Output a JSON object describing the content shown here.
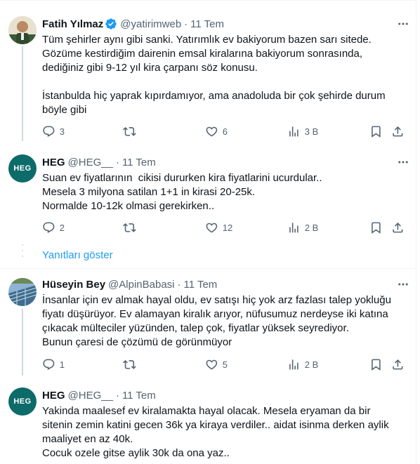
{
  "tweets": [
    {
      "name": "Fatih Yılmaz",
      "handle": "@yatirimweb",
      "date": "11 Tem",
      "text": "Tüm şehirler aynı gibi sanki. Yatırımlık ev bakiyorum bazen sarı sitede.\nGözüme kestirdiğim dairenin emsal kiralarına bakiyorum sonrasında,\ndediğiniz gibi 9-12 yıl kira çarpanı söz konusu.\n\nİstanbulda hiç yaprak kıpırdamıyor, ama anadoluda bir çok şehirde durum\nböyle gibi",
      "replies": "3",
      "retweets": "",
      "likes": "6",
      "views": "3 B"
    },
    {
      "name": "HEG",
      "handle": "@HEG__",
      "date": "11 Tem",
      "avatar_text": "HEG",
      "text": "Suan ev fiyatlarının  cikisi dururken kira fiyatlarini ucurdular..\nMesela 3 milyona satilan 1+1 in kirasi 20-25k.\nNormalde 10-12k olmasi gerekirken..",
      "replies": "2",
      "retweets": "",
      "likes": "12",
      "views": "2 B"
    },
    {
      "name": "Hüseyin Bey",
      "handle": "@AlpinBabasi",
      "date": "11 Tem",
      "text": "İnsanlar için ev almak hayal oldu, ev satışı hiç yok arz fazlası talep yokluğu\nfiyatı düşürüyor. Ev alamayan kiralık arıyor, nüfusumuz nerdeyse iki katına\nçıkacak mülteciler yüzünden, talep çok, fiyatlar yüksek seyrediyor.\nBunun çaresi de çözümü de görünmüyor",
      "replies": "1",
      "retweets": "",
      "likes": "5",
      "views": "2 B"
    },
    {
      "name": "HEG",
      "handle": "@HEG__",
      "date": "11 Tem",
      "avatar_text": "HEG",
      "text": "Yakinda maalesef ev kiralamakta hayal olacak. Mesela eryaman da bir\nsitenin zemin katini gecen 36k ya kiraya verdiler.. aidat isinma derken aylik\nmaaliyet en az 40k.\nCocuk ozele gitse aylik 30k da ona yaz..",
      "replies": "",
      "retweets": "",
      "likes": "",
      "views": ""
    }
  ],
  "show_replies_label": "Yanıtları göster",
  "dot_separator": "·",
  "colors": {
    "accent": "#1d9bf0",
    "secondary_text": "#536471",
    "border": "#eff3f4",
    "heg_avatar": "#0d6b6a"
  },
  "icons": [
    "verified-badge-icon",
    "more-icon",
    "reply-icon",
    "retweet-icon",
    "like-icon",
    "views-icon",
    "bookmark-icon",
    "share-icon"
  ]
}
